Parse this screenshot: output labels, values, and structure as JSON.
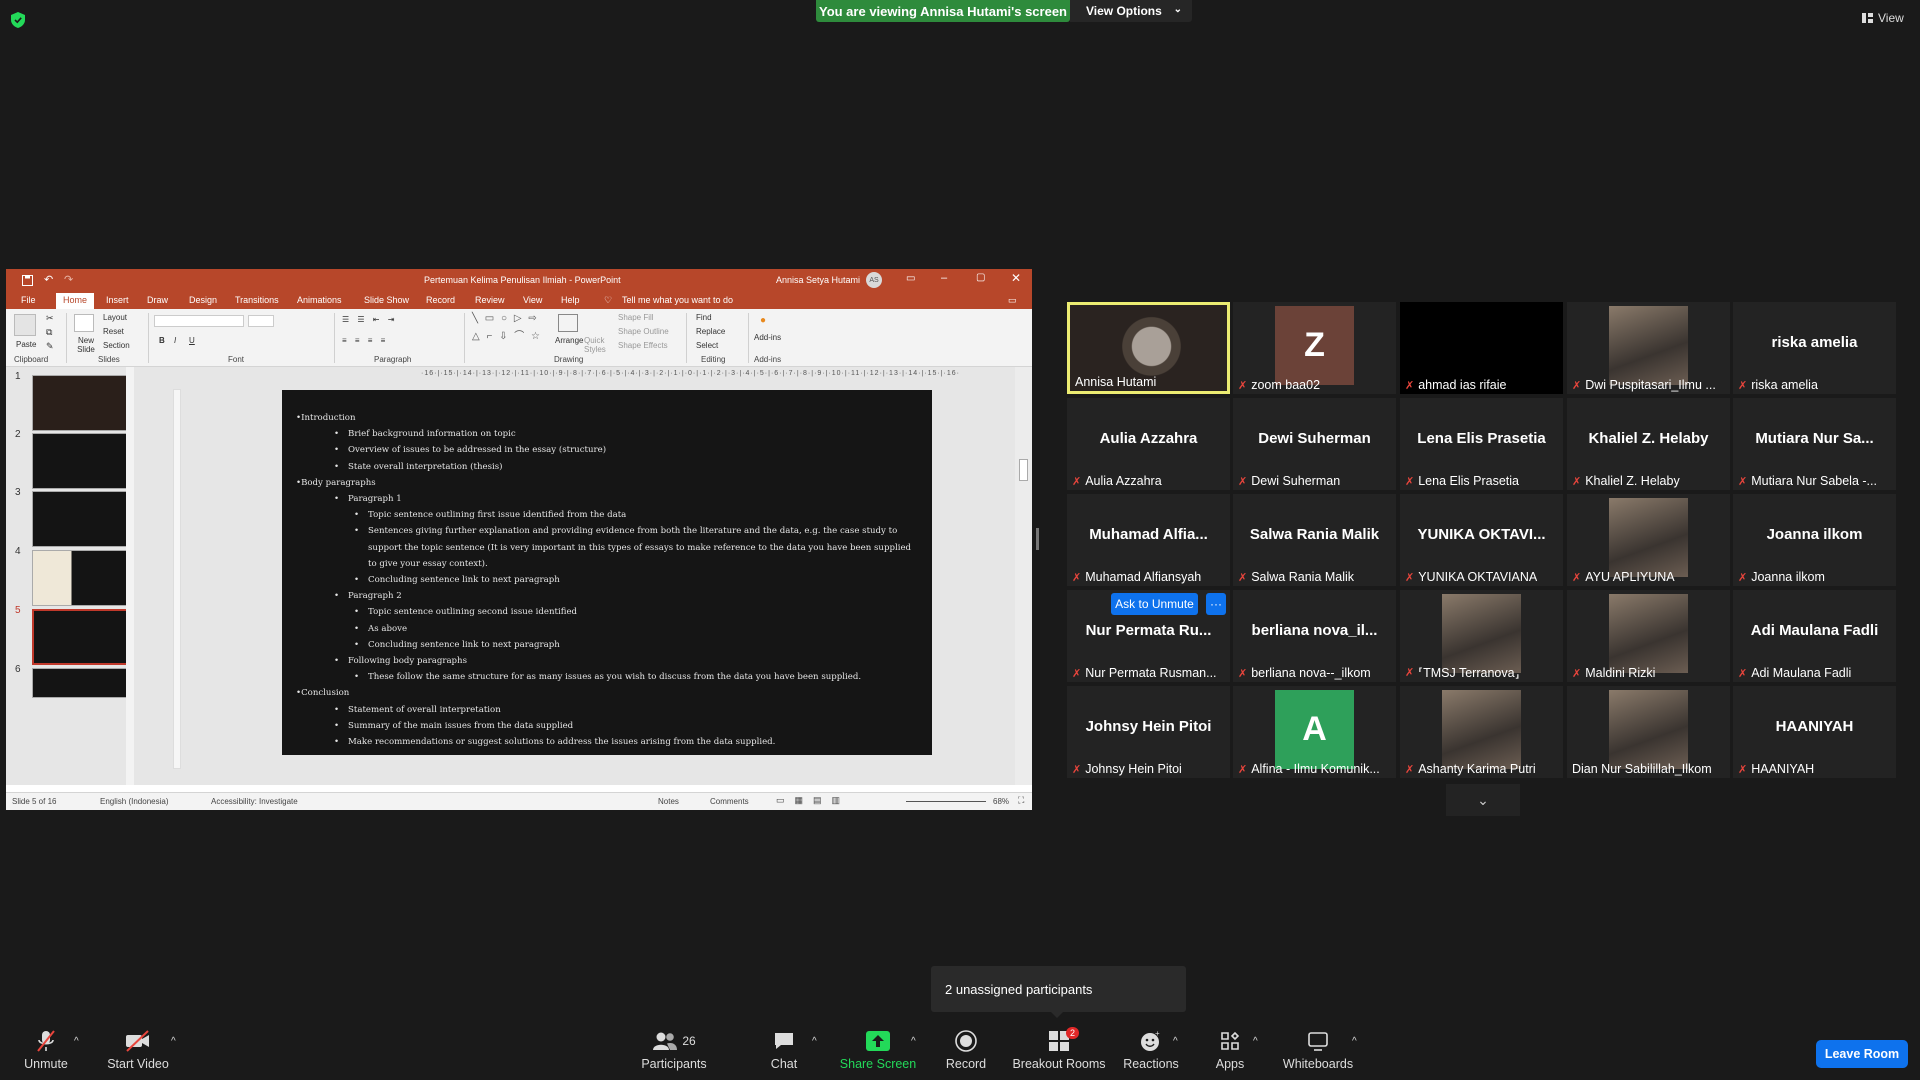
{
  "banner": {
    "viewing": "You are viewing Annisa Hutami's screen",
    "view_options": "View Options",
    "view": "View"
  },
  "ppt": {
    "title": "Pertemuan Kelima Penulisan Ilmiah  -  PowerPoint",
    "user": "Annisa Setya Hutami",
    "user_initials": "AS",
    "tabs": [
      "File",
      "Home",
      "Insert",
      "Draw",
      "Design",
      "Transitions",
      "Animations",
      "Slide Show",
      "Record",
      "Review",
      "View",
      "Help"
    ],
    "tell_me": "Tell me what you want to do",
    "ribbon": {
      "paste": "Paste",
      "new_slide": "New Slide",
      "layout": "Layout",
      "reset": "Reset",
      "section": "Section",
      "arrange": "Arrange",
      "quick_styles": "Quick Styles",
      "shape_fill": "Shape Fill",
      "shape_outline": "Shape Outline",
      "shape_effects": "Shape Effects",
      "find": "Find",
      "replace": "Replace",
      "select": "Select",
      "addins": "Add-ins",
      "groups": {
        "clipboard": "Clipboard",
        "slides": "Slides",
        "font": "Font",
        "paragraph": "Paragraph",
        "drawing": "Drawing",
        "editing": "Editing",
        "addins": "Add-ins"
      }
    },
    "thumb_numbers": [
      "1",
      "2",
      "3",
      "4",
      "5",
      "6"
    ],
    "ruler": "·16·|·15·|·14·|·13·|·12·|·11·|·10·|·9·|·8·|·7·|·6·|·5·|·4·|·3·|·2·|·1·|·0·|·1·|·2·|·3·|·4·|·5·|·6·|·7·|·8·|·9·|·10·|·11·|·12·|·13·|·14·|·15·|·16·",
    "slide_lines": [
      "•Introduction",
      "Brief background information on topic",
      "Overview of issues to be addressed in the essay (structure)",
      "State overall interpretation (thesis)",
      "•Body paragraphs",
      "Paragraph 1",
      "Topic sentence outlining first issue identified from the data",
      "Sentences giving further explanation and providing evidence from both the literature and the data, e.g. the case study to support the topic sentence (It is very important in this types of essays to make reference to the data you have been supplied to give your essay context).",
      "Concluding sentence link to next paragraph",
      "Paragraph 2",
      "Topic sentence outlining second issue identified",
      "As above",
      "Concluding sentence link to next paragraph",
      "Following body paragraphs",
      "These follow the same structure for as many issues as you wish to discuss from the data you have been supplied.",
      "•Conclusion",
      "Statement of overall interpretation",
      "Summary of the main issues from the data supplied",
      "Make recommendations or suggest solutions to address the issues arising from the data supplied."
    ],
    "status": {
      "slide": "Slide 5 of 16",
      "language": "English (Indonesia)",
      "accessibility": "Accessibility: Investigate",
      "notes": "Notes",
      "comments": "Comments",
      "zoom": "68%"
    }
  },
  "participants": [
    {
      "big": "",
      "name": "Annisa Hutami",
      "muted": false,
      "video": true
    },
    {
      "big": "Z",
      "name": "zoom baa02",
      "muted": true,
      "avatar": "#6b4238"
    },
    {
      "big": "",
      "name": "ahmad ias rifaie",
      "muted": true,
      "black": true
    },
    {
      "big": "",
      "name": "Dwi Puspitasari_Ilmu ...",
      "muted": true,
      "video": true
    },
    {
      "big": "riska amelia",
      "name": "riska amelia",
      "muted": true
    },
    {
      "big": "Aulia Azzahra",
      "name": "Aulia Azzahra",
      "muted": true
    },
    {
      "big": "Dewi Suherman",
      "name": "Dewi Suherman",
      "muted": true
    },
    {
      "big": "Lena Elis Prasetia",
      "name": "Lena Elis Prasetia",
      "muted": true
    },
    {
      "big": "Khaliel Z. Helaby",
      "name": "Khaliel Z. Helaby",
      "muted": true
    },
    {
      "big": "Mutiara  Nur  Sa...",
      "name": "Mutiara Nur Sabela -...",
      "muted": true
    },
    {
      "big": "Muhamad  Alfia...",
      "name": "Muhamad Alfiansyah",
      "muted": true
    },
    {
      "big": "Salwa Rania Malik",
      "name": "Salwa Rania Malik",
      "muted": true
    },
    {
      "big": "YUNIKA  OKTAVI...",
      "name": "YUNIKA OKTAVIANA",
      "muted": true
    },
    {
      "big": "",
      "name": "AYU APLIYUNA",
      "muted": true,
      "video": true
    },
    {
      "big": "Joanna ilkom",
      "name": "Joanna ilkom",
      "muted": true
    },
    {
      "big": "Nur  Permata  Ru...",
      "name": "Nur Permata Rusman...",
      "muted": true
    },
    {
      "big": "berliana  nova_il...",
      "name": "berliana nova--_ilkom",
      "muted": true
    },
    {
      "big": "",
      "name": "⸢TMSJ Terranova⸥",
      "muted": true,
      "video": true
    },
    {
      "big": "",
      "name": "Maldini Rizki",
      "muted": true,
      "video": true
    },
    {
      "big": "Adi Maulana Fadli",
      "name": "Adi Maulana Fadli",
      "muted": true
    },
    {
      "big": "Johnsy Hein Pitoi",
      "name": "Johnsy Hein Pitoi",
      "muted": true
    },
    {
      "big": "A",
      "name": "Alfina - Ilmu Komunik...",
      "muted": true,
      "avatar": "#2ea05a"
    },
    {
      "big": "",
      "name": "Ashanty Karima Putri",
      "muted": true,
      "video": true
    },
    {
      "big": "",
      "name": "Dian Nur Sabilillah_Ilkom",
      "muted": false,
      "video": true
    },
    {
      "big": "HAANIYAH",
      "name": "HAANIYAH",
      "muted": true
    }
  ],
  "ask_unmute": "Ask to Unmute",
  "ask_more": "···",
  "unassigned": "2 unassigned participants",
  "toolbar": {
    "unmute": "Unmute",
    "start_video": "Start Video",
    "participants": "Participants",
    "participants_count": "26",
    "chat": "Chat",
    "share_screen": "Share Screen",
    "record": "Record",
    "breakout_rooms": "Breakout Rooms",
    "breakout_badge": "2",
    "reactions": "Reactions",
    "apps": "Apps",
    "whiteboards": "Whiteboards",
    "leave": "Leave Room"
  },
  "colors": {
    "share_green": "#2e8b3c",
    "zoom_blue": "#0e72ed",
    "ppt_red": "#b7472a",
    "active_speaker": "#ecec72",
    "muted_red": "#e8453c"
  }
}
